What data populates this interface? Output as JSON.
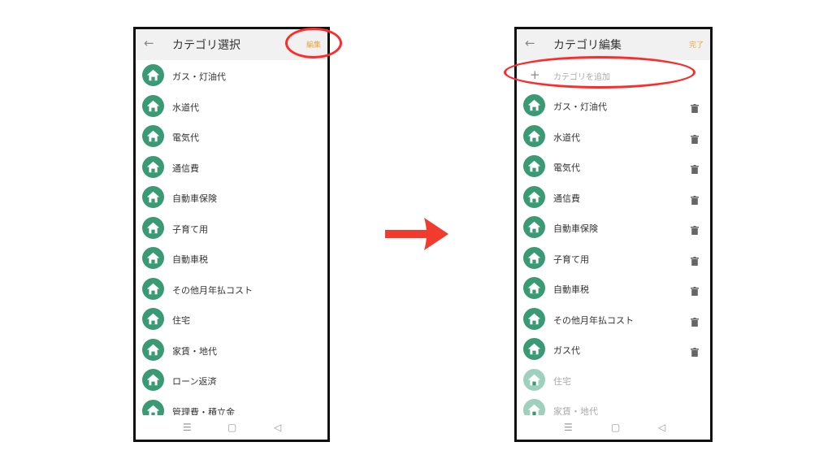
{
  "left_screen": {
    "title": "カテゴリ選択",
    "action_label": "編集",
    "back_icon": "back-arrow-icon",
    "items": [
      {
        "label": "ガス・灯油代",
        "icon": "home-icon"
      },
      {
        "label": "水道代",
        "icon": "home-icon"
      },
      {
        "label": "電気代",
        "icon": "home-icon"
      },
      {
        "label": "通信費",
        "icon": "home-icon"
      },
      {
        "label": "自動車保険",
        "icon": "home-icon"
      },
      {
        "label": "子育て用",
        "icon": "home-icon"
      },
      {
        "label": "自動車税",
        "icon": "home-icon"
      },
      {
        "label": "その他月年払コスト",
        "icon": "home-icon"
      },
      {
        "label": "住宅",
        "icon": "home-icon"
      },
      {
        "label": "家賃・地代",
        "icon": "home-icon"
      },
      {
        "label": "ローン返済",
        "icon": "home-icon"
      },
      {
        "label": "管理費・積立金",
        "icon": "home-icon"
      }
    ]
  },
  "right_screen": {
    "title": "カテゴリ編集",
    "action_label": "完了",
    "back_icon": "back-arrow-icon",
    "add_symbol": "+",
    "add_label": "カテゴリを追加",
    "items": [
      {
        "label": "ガス・灯油代",
        "icon": "home-icon",
        "trash": true
      },
      {
        "label": "水道代",
        "icon": "home-icon",
        "trash": true
      },
      {
        "label": "電気代",
        "icon": "home-icon",
        "trash": true
      },
      {
        "label": "通信費",
        "icon": "home-icon",
        "trash": true
      },
      {
        "label": "自動車保険",
        "icon": "home-icon",
        "trash": true
      },
      {
        "label": "子育て用",
        "icon": "home-icon",
        "trash": true
      },
      {
        "label": "自動車税",
        "icon": "home-icon",
        "trash": true
      },
      {
        "label": "その他月年払コスト",
        "icon": "home-icon",
        "trash": true
      },
      {
        "label": "ガス代",
        "icon": "home-icon",
        "trash": true
      },
      {
        "label": "住宅",
        "icon": "home-icon",
        "trash": false
      },
      {
        "label": "家賃・地代",
        "icon": "home-icon",
        "trash": false
      }
    ]
  },
  "nav_bar": {
    "menu": "☰",
    "home": "▢",
    "back": "◁"
  },
  "colors": {
    "accent_orange": "#f2a23a",
    "category_green": "#3a9a74",
    "category_green_faded": "#9fd0bd",
    "highlight_red": "#ff2a2a",
    "appbar_bg": "#f1f1f1"
  }
}
